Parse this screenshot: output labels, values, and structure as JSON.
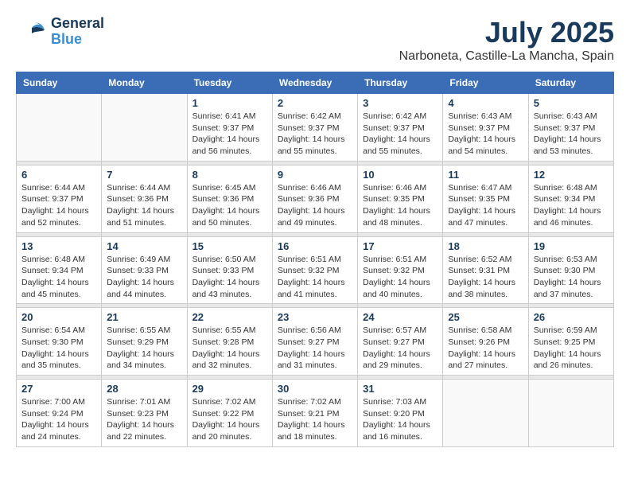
{
  "header": {
    "logo_general": "General",
    "logo_blue": "Blue",
    "month_year": "July 2025",
    "location": "Narboneta, Castille-La Mancha, Spain"
  },
  "days_of_week": [
    "Sunday",
    "Monday",
    "Tuesday",
    "Wednesday",
    "Thursday",
    "Friday",
    "Saturday"
  ],
  "weeks": [
    [
      {
        "day": "",
        "info": ""
      },
      {
        "day": "",
        "info": ""
      },
      {
        "day": "1",
        "info": "Sunrise: 6:41 AM\nSunset: 9:37 PM\nDaylight: 14 hours\nand 56 minutes."
      },
      {
        "day": "2",
        "info": "Sunrise: 6:42 AM\nSunset: 9:37 PM\nDaylight: 14 hours\nand 55 minutes."
      },
      {
        "day": "3",
        "info": "Sunrise: 6:42 AM\nSunset: 9:37 PM\nDaylight: 14 hours\nand 55 minutes."
      },
      {
        "day": "4",
        "info": "Sunrise: 6:43 AM\nSunset: 9:37 PM\nDaylight: 14 hours\nand 54 minutes."
      },
      {
        "day": "5",
        "info": "Sunrise: 6:43 AM\nSunset: 9:37 PM\nDaylight: 14 hours\nand 53 minutes."
      }
    ],
    [
      {
        "day": "6",
        "info": "Sunrise: 6:44 AM\nSunset: 9:37 PM\nDaylight: 14 hours\nand 52 minutes."
      },
      {
        "day": "7",
        "info": "Sunrise: 6:44 AM\nSunset: 9:36 PM\nDaylight: 14 hours\nand 51 minutes."
      },
      {
        "day": "8",
        "info": "Sunrise: 6:45 AM\nSunset: 9:36 PM\nDaylight: 14 hours\nand 50 minutes."
      },
      {
        "day": "9",
        "info": "Sunrise: 6:46 AM\nSunset: 9:36 PM\nDaylight: 14 hours\nand 49 minutes."
      },
      {
        "day": "10",
        "info": "Sunrise: 6:46 AM\nSunset: 9:35 PM\nDaylight: 14 hours\nand 48 minutes."
      },
      {
        "day": "11",
        "info": "Sunrise: 6:47 AM\nSunset: 9:35 PM\nDaylight: 14 hours\nand 47 minutes."
      },
      {
        "day": "12",
        "info": "Sunrise: 6:48 AM\nSunset: 9:34 PM\nDaylight: 14 hours\nand 46 minutes."
      }
    ],
    [
      {
        "day": "13",
        "info": "Sunrise: 6:48 AM\nSunset: 9:34 PM\nDaylight: 14 hours\nand 45 minutes."
      },
      {
        "day": "14",
        "info": "Sunrise: 6:49 AM\nSunset: 9:33 PM\nDaylight: 14 hours\nand 44 minutes."
      },
      {
        "day": "15",
        "info": "Sunrise: 6:50 AM\nSunset: 9:33 PM\nDaylight: 14 hours\nand 43 minutes."
      },
      {
        "day": "16",
        "info": "Sunrise: 6:51 AM\nSunset: 9:32 PM\nDaylight: 14 hours\nand 41 minutes."
      },
      {
        "day": "17",
        "info": "Sunrise: 6:51 AM\nSunset: 9:32 PM\nDaylight: 14 hours\nand 40 minutes."
      },
      {
        "day": "18",
        "info": "Sunrise: 6:52 AM\nSunset: 9:31 PM\nDaylight: 14 hours\nand 38 minutes."
      },
      {
        "day": "19",
        "info": "Sunrise: 6:53 AM\nSunset: 9:30 PM\nDaylight: 14 hours\nand 37 minutes."
      }
    ],
    [
      {
        "day": "20",
        "info": "Sunrise: 6:54 AM\nSunset: 9:30 PM\nDaylight: 14 hours\nand 35 minutes."
      },
      {
        "day": "21",
        "info": "Sunrise: 6:55 AM\nSunset: 9:29 PM\nDaylight: 14 hours\nand 34 minutes."
      },
      {
        "day": "22",
        "info": "Sunrise: 6:55 AM\nSunset: 9:28 PM\nDaylight: 14 hours\nand 32 minutes."
      },
      {
        "day": "23",
        "info": "Sunrise: 6:56 AM\nSunset: 9:27 PM\nDaylight: 14 hours\nand 31 minutes."
      },
      {
        "day": "24",
        "info": "Sunrise: 6:57 AM\nSunset: 9:27 PM\nDaylight: 14 hours\nand 29 minutes."
      },
      {
        "day": "25",
        "info": "Sunrise: 6:58 AM\nSunset: 9:26 PM\nDaylight: 14 hours\nand 27 minutes."
      },
      {
        "day": "26",
        "info": "Sunrise: 6:59 AM\nSunset: 9:25 PM\nDaylight: 14 hours\nand 26 minutes."
      }
    ],
    [
      {
        "day": "27",
        "info": "Sunrise: 7:00 AM\nSunset: 9:24 PM\nDaylight: 14 hours\nand 24 minutes."
      },
      {
        "day": "28",
        "info": "Sunrise: 7:01 AM\nSunset: 9:23 PM\nDaylight: 14 hours\nand 22 minutes."
      },
      {
        "day": "29",
        "info": "Sunrise: 7:02 AM\nSunset: 9:22 PM\nDaylight: 14 hours\nand 20 minutes."
      },
      {
        "day": "30",
        "info": "Sunrise: 7:02 AM\nSunset: 9:21 PM\nDaylight: 14 hours\nand 18 minutes."
      },
      {
        "day": "31",
        "info": "Sunrise: 7:03 AM\nSunset: 9:20 PM\nDaylight: 14 hours\nand 16 minutes."
      },
      {
        "day": "",
        "info": ""
      },
      {
        "day": "",
        "info": ""
      }
    ]
  ]
}
